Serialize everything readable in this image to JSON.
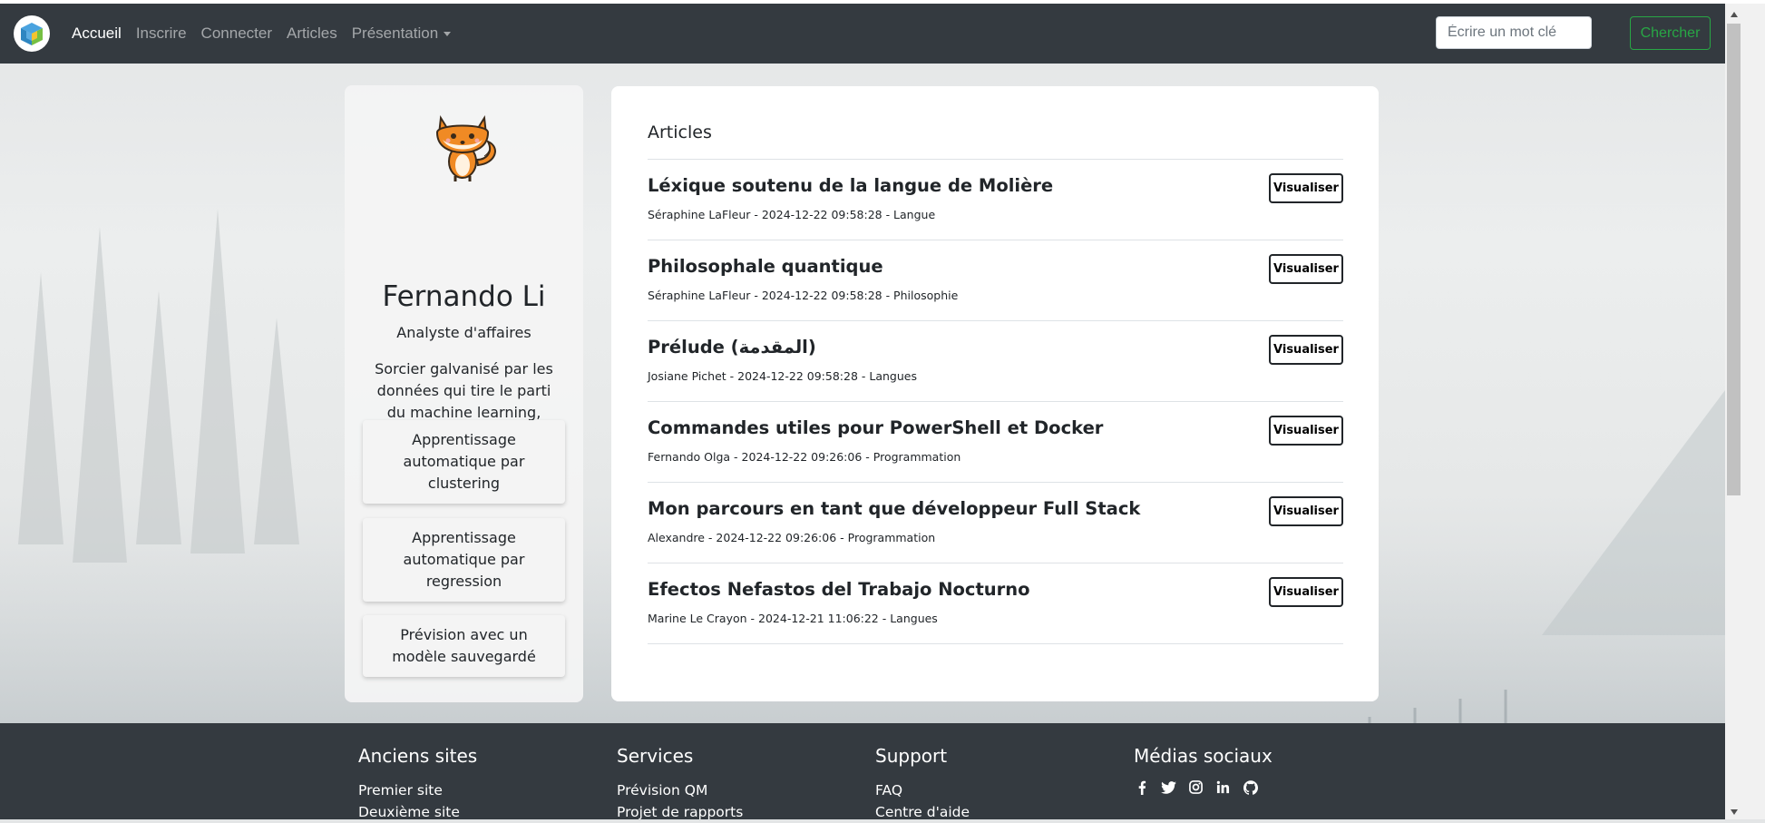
{
  "navbar": {
    "logo_icon": "cube-logo-icon",
    "links": [
      {
        "label": "Accueil",
        "active": true
      },
      {
        "label": "Inscrire",
        "active": false
      },
      {
        "label": "Connecter",
        "active": false
      },
      {
        "label": "Articles",
        "active": false
      },
      {
        "label": "Présentation",
        "active": false,
        "dropdown": true
      }
    ],
    "search": {
      "placeholder": "Écrire un mot clé",
      "value": ""
    },
    "search_button": "Chercher"
  },
  "profile": {
    "avatar_icon": "fox-avatar",
    "name": "Fernando Li",
    "role": "Analyste d'affaires",
    "bio": "Sorcier galvanisé par les données qui tire le parti du machine learning, ayant pour vocation de découvrir le mystère dissimulé",
    "topics": [
      {
        "label": "Apprentissage automatique par clustering"
      },
      {
        "label": "Apprentissage automatique par regression"
      },
      {
        "label": "Prévision avec un modèle sauvegardé"
      }
    ]
  },
  "articles": {
    "heading": "Articles",
    "view_label": "Visualiser",
    "items": [
      {
        "title": "Léxique soutenu de la langue de Molière",
        "meta": "Séraphine LaFleur - 2024-12-22 09:58:28 - Langue"
      },
      {
        "title": "Philosophale quantique",
        "meta": "Séraphine LaFleur - 2024-12-22 09:58:28 - Philosophie"
      },
      {
        "title": "Prélude (المقدمة)",
        "meta": "Josiane Pichet - 2024-12-22 09:58:28 - Langues"
      },
      {
        "title": "Commandes utiles pour PowerShell et Docker",
        "meta": "Fernando Olga - 2024-12-22 09:26:06 - Programmation"
      },
      {
        "title": "Mon parcours en tant que développeur Full Stack",
        "meta": "Alexandre - 2024-12-22 09:26:06 - Programmation"
      },
      {
        "title": "Efectos Nefastos del Trabajo Nocturno",
        "meta": "Marine Le Crayon - 2024-12-21 11:06:22 - Langues"
      }
    ]
  },
  "footer": {
    "columns": [
      {
        "heading": "Anciens sites",
        "links": [
          "Premier site",
          "Deuxième site"
        ]
      },
      {
        "heading": "Services",
        "links": [
          "Prévision QM",
          "Projet de rapports"
        ]
      },
      {
        "heading": "Support",
        "links": [
          "FAQ",
          "Centre d'aide"
        ]
      }
    ],
    "social": {
      "heading": "Médias sociaux",
      "icons": [
        "facebook-icon",
        "twitter-icon",
        "instagram-icon",
        "linkedin-icon",
        "github-icon"
      ]
    }
  },
  "colors": {
    "navbar": "#343a40",
    "search_accent": "#28a745",
    "card": "#ffffff"
  }
}
